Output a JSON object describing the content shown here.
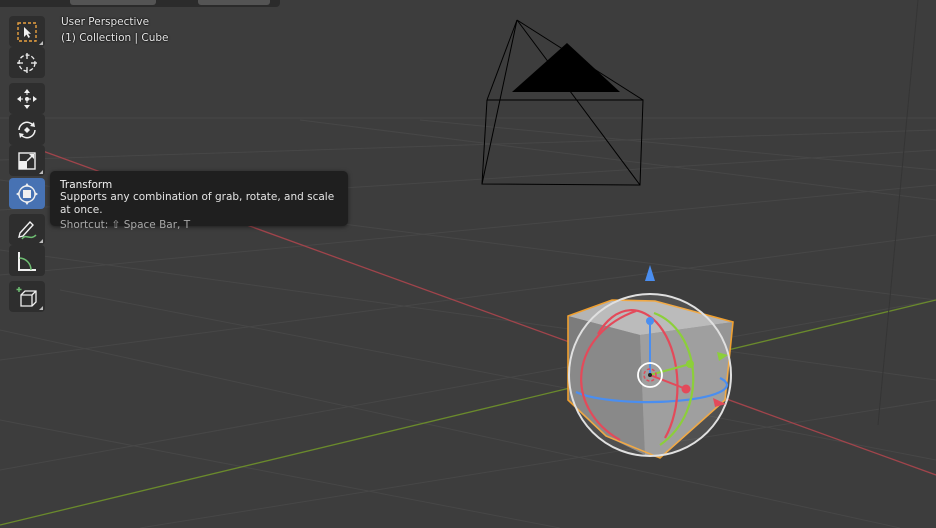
{
  "viewport": {
    "perspective_label": "User Perspective",
    "collection_label": "(1) Collection | Cube"
  },
  "toolbar": {
    "tools": [
      {
        "name": "select-box",
        "icon": "select-box-icon"
      },
      {
        "name": "cursor",
        "icon": "cursor-icon"
      },
      {
        "name": "move",
        "icon": "move-icon"
      },
      {
        "name": "rotate",
        "icon": "rotate-icon"
      },
      {
        "name": "scale",
        "icon": "scale-icon"
      },
      {
        "name": "transform",
        "icon": "transform-icon",
        "active": true
      },
      {
        "name": "annotate",
        "icon": "annotate-icon"
      },
      {
        "name": "measure",
        "icon": "measure-icon"
      },
      {
        "name": "add-cube",
        "icon": "add-cube-icon"
      }
    ]
  },
  "tooltip": {
    "title": "Transform",
    "description": "Supports any combination of grab, rotate, and scale at once.",
    "shortcut": "Shortcut: ⇧ Space Bar, T"
  },
  "colors": {
    "background": "#3d3d3d",
    "grid": "#474747",
    "x_axis": "#a0444b",
    "y_axis": "#6a8a2c",
    "active_tool": "#4772b3",
    "selection_outline": "#f0a030",
    "gizmo_x": "#e34a5a",
    "gizmo_y": "#8ccf3a",
    "gizmo_z": "#4a8ef0"
  }
}
